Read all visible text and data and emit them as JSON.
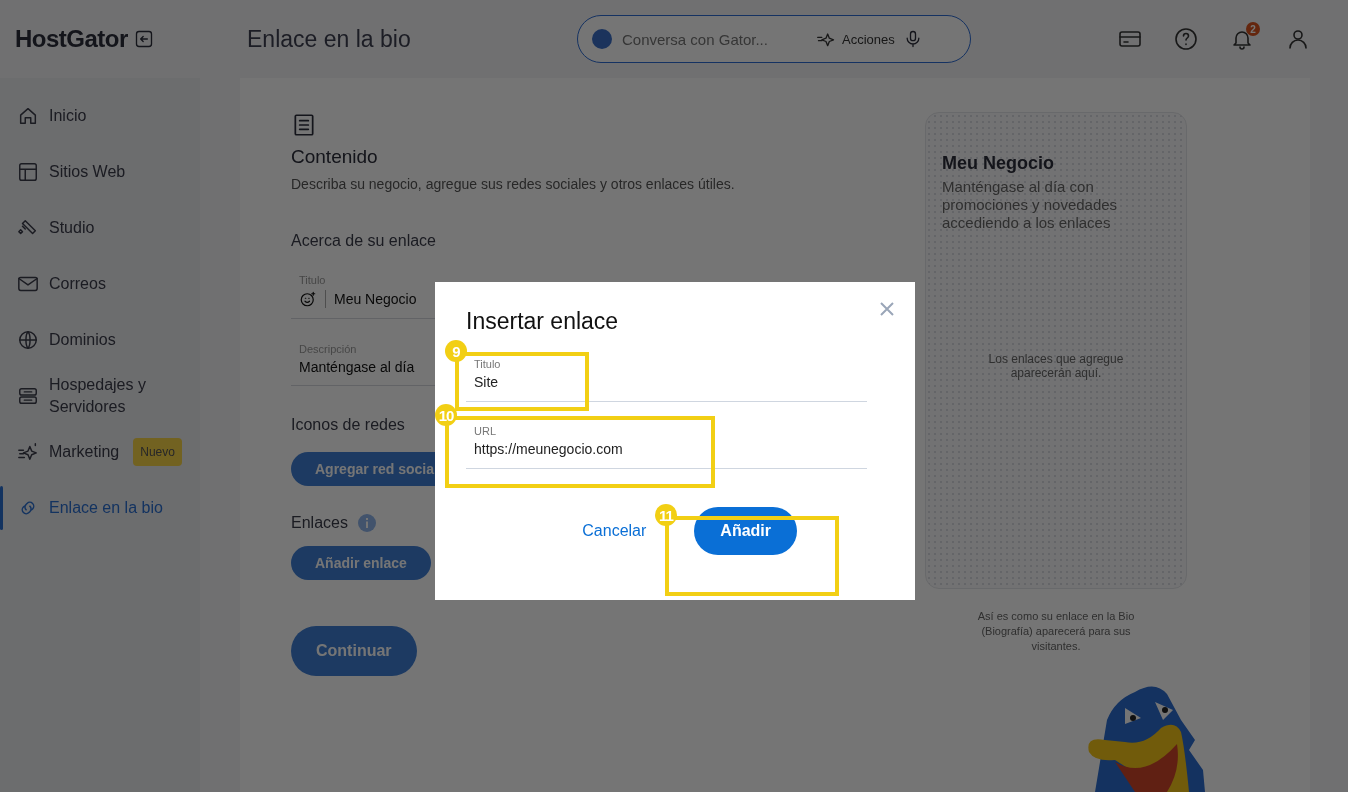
{
  "sidebar": {
    "logo": "HostGator",
    "items": [
      {
        "label": "Inicio",
        "selected": false
      },
      {
        "label": "Sitios Web",
        "selected": false
      },
      {
        "label": "Studio",
        "selected": false
      },
      {
        "label": "Correos",
        "selected": false
      },
      {
        "label": "Dominios",
        "selected": false
      },
      {
        "label": "Hospedajes y Servidores",
        "selected": false
      },
      {
        "label": "Marketing",
        "badge": "Nuevo",
        "selected": false
      },
      {
        "label": "Enlace en la bio",
        "selected": true
      }
    ]
  },
  "header": {
    "title": "Enlace en la bio",
    "assistant": {
      "placeholder": "Conversa con Gator...",
      "actions": "Acciones"
    },
    "notification_count": "2"
  },
  "content": {
    "section_title": "Contenido",
    "section_description": "Describa su negocio, agregue sus redes sociales y otros enlaces útiles.",
    "about_heading": "Acerca de su enlace",
    "fields": [
      {
        "label": "Titulo",
        "value": "Meu Negocio",
        "kind": "emoji"
      },
      {
        "label": "Descripción",
        "value": "Manténgase al día",
        "kind": "plain"
      }
    ],
    "social_heading": "Iconos de redes",
    "social_button": "Agregar red socia",
    "links_heading": "Enlaces",
    "add_link_button": "Añadir enlace",
    "continue_button": "Continuar"
  },
  "preview": {
    "title": "Meu Negocio",
    "description": "Manténgase al día con promociones y novedades accediendo a los enlaces",
    "empty_text": "Los enlaces que agregue aparecerán aquí.",
    "caption": "Así es como su enlace en la Bio (Biografía) aparecerá para sus visitantes."
  },
  "dialog": {
    "title": "Insertar enlace",
    "fields": [
      {
        "label": "Titulo",
        "value": "Site"
      },
      {
        "label": "URL",
        "value": "https://meunegocio.com"
      }
    ],
    "cancel": "Cancelar",
    "confirm": "Añadir"
  },
  "callouts": [
    {
      "number": "9"
    },
    {
      "number": "10"
    },
    {
      "number": "11"
    }
  ]
}
